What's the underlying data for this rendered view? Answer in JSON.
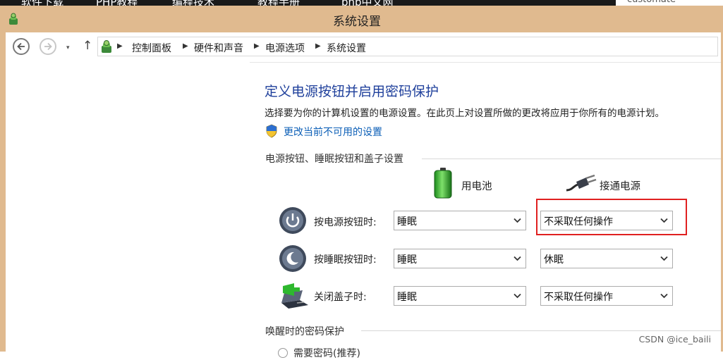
{
  "window": {
    "title": "系统设置"
  },
  "top_strip": {
    "tabs": [
      "软件下载",
      "PHP教程",
      "编程技术",
      "教程手册",
      "php中文网"
    ],
    "right_text": "customate"
  },
  "nav": {
    "back_icon": "back-arrow-icon",
    "forward_icon": "forward-arrow-icon",
    "recent_icon": "chevron-down-icon",
    "up_icon": "up-arrow-icon",
    "up_glyph": "↑",
    "dropdown_glyph": "▾",
    "breadcrumb": [
      "控制面板",
      "硬件和声音",
      "电源选项",
      "系统设置"
    ],
    "separator": "▶"
  },
  "main": {
    "heading": "定义电源按钮并启用密码保护",
    "description": "选择要为你的计算机设置的电源设置。在此页上对设置所做的更改将应用于你所有的电源计划。",
    "change_link": "更改当前不可用的设置",
    "section_buttons": "电源按钮、睡眠按钮和盖子设置",
    "col_battery": "用电池",
    "col_plugged": "接通电源",
    "rows": [
      {
        "label": "按电源按钮时:",
        "battery": "睡眠",
        "plugged": "不采取任何操作",
        "icon": "power-button-icon"
      },
      {
        "label": "按睡眠按钮时:",
        "battery": "睡眠",
        "plugged": "休眠",
        "icon": "sleep-button-icon"
      },
      {
        "label": "关闭盖子时:",
        "battery": "睡眠",
        "plugged": "不采取任何操作",
        "icon": "laptop-lid-icon"
      }
    ],
    "section_password": "唤醒时的密码保护",
    "password_option_partial": "需要密码(推荐)"
  },
  "watermark": "CSDN @ice_baili",
  "colors": {
    "titlebar": "#e0ba8f",
    "heading": "#1e3f9b",
    "link": "#0c5fb7",
    "highlight": "#e02020"
  }
}
